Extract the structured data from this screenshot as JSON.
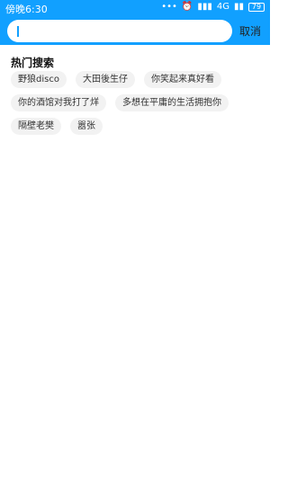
{
  "status_bar": {
    "time": "傍晚6:30",
    "network": "4G",
    "battery": "79"
  },
  "search": {
    "value": "",
    "cancel_label": "取消"
  },
  "hot_search": {
    "title": "热门搜索",
    "tags": [
      [
        "野狼disco",
        "大田後生仔",
        "你笑起来真好看"
      ],
      [
        "你的酒馆对我打了烊",
        "多想在平庸的生活拥抱你"
      ],
      [
        "隔壁老樊",
        "嚣张"
      ]
    ]
  },
  "colors": {
    "header": "#11a0ff",
    "tag_bg": "#f2f2f2"
  }
}
